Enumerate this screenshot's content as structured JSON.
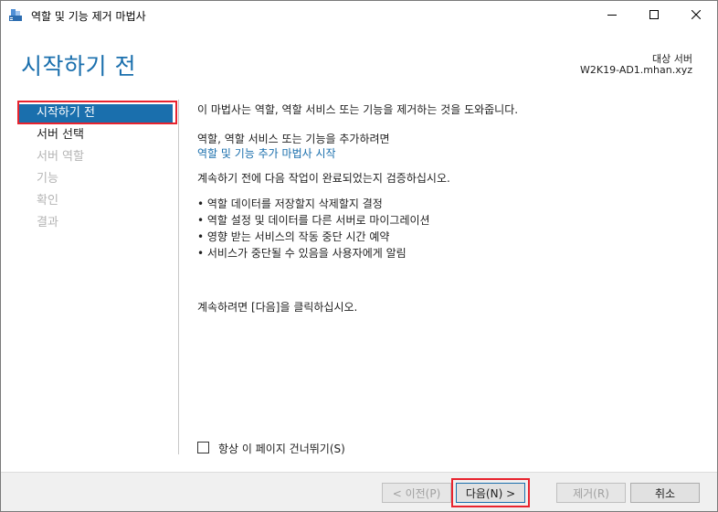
{
  "window": {
    "title": "역할 및 기능 제거 마법사"
  },
  "header": {
    "page_title": "시작하기 전",
    "dest_label": "대상 서버",
    "dest_value": "W2K19-AD1.mhan.xyz"
  },
  "nav": {
    "items": [
      {
        "label": "시작하기 전",
        "state": "active"
      },
      {
        "label": "서버 선택",
        "state": "enabled"
      },
      {
        "label": "서버 역할",
        "state": "disabled"
      },
      {
        "label": "기능",
        "state": "disabled"
      },
      {
        "label": "확인",
        "state": "disabled"
      },
      {
        "label": "결과",
        "state": "disabled"
      }
    ]
  },
  "content": {
    "intro": "이 마법사는 역할, 역할 서비스 또는 기능을 제거하는 것을 도와줍니다.",
    "add_prompt": "역할, 역할 서비스 또는 기능을 추가하려면",
    "add_link": "역할 및 기능 추가 마법사 시작",
    "verify_text": "계속하기 전에 다음 작업이 완료되었는지 검증하십시오.",
    "bullets": [
      "• 역할 데이터를 저장할지 삭제할지 결정",
      "• 역할 설정 및 데이터를 다른 서버로 마이그레이션",
      "• 영향 받는 서비스의 작동 중단 시간 예약",
      "• 서비스가 중단될 수 있음을 사용자에게 알림"
    ],
    "continue_text": "계속하려면 [다음]을 클릭하십시오.",
    "skip_label": "항상 이 페이지 건너뛰기(S)"
  },
  "footer": {
    "prev_label": "< 이전(P)",
    "next_label": "다음(N) >",
    "remove_label": "제거(R)",
    "cancel_label": "취소"
  },
  "colors": {
    "accent": "#1a6fad",
    "highlight": "#e8232e",
    "disabled_text": "#b4b4b4"
  }
}
